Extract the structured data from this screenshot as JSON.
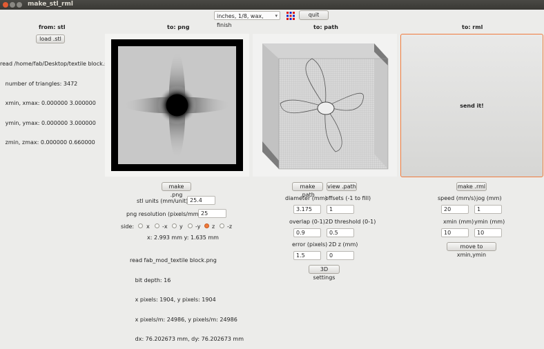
{
  "window": {
    "title": "make_stl_rml"
  },
  "toolbar": {
    "process": "inches, 1/8, wax, finish",
    "quit": "quit"
  },
  "columns": {
    "stl": {
      "header": "from: stl",
      "load": "load .stl",
      "info": [
        "read /home/fab/Desktop/textile block.stl",
        "   number of triangles: 3472",
        "   xmin, xmax: 0.000000 3.000000",
        "   ymin, ymax: 0.000000 3.000000",
        "   zmin, zmax: 0.000000 0.660000"
      ]
    },
    "png": {
      "header": "to: png",
      "make": "make .png",
      "units_label": "stl units (mm/unit):",
      "units_value": "25.4",
      "res_label": "png resolution (pixels/mm):",
      "res_value": "25",
      "side_label": "side:",
      "sides": [
        "x",
        "-x",
        "y",
        "-y",
        "z",
        "-z"
      ],
      "side_selected": "z",
      "coords": "x: 2.993 mm  y: 1.635 mm",
      "info": [
        "read fab_mod_textile block.png",
        "   bit depth: 16",
        "   x pixels: 1904, y pixels: 1904",
        "   x pixels/m: 24986, y pixels/m: 24986",
        "   dx: 76.202673 mm, dy: 76.202673 mm"
      ]
    },
    "path": {
      "header": "to: path",
      "make": "make .path",
      "view": "view .path",
      "diameter_label": "diameter (mm)",
      "diameter_value": "3.175",
      "offsets_label": "offsets (-1 to fill)",
      "offsets_value": "1",
      "overlap_label": "overlap (0-1)",
      "overlap_value": "0.9",
      "threshold_label": "2D threshold (0-1)",
      "threshold_value": "0.5",
      "error_label": "error (pixels)",
      "error_value": "1.5",
      "z2d_label": "2D z (mm)",
      "z2d_value": "0",
      "settings3d": "3D settings"
    },
    "rml": {
      "header": "to: rml",
      "send": "send it!",
      "make": "make .rml",
      "speed_label": "speed (mm/s)",
      "speed_value": "20",
      "jog_label": "jog (mm)",
      "jog_value": "1",
      "xmin_label": "xmin (mm)",
      "xmin_value": "10",
      "ymin_label": "ymin (mm)",
      "ymin_value": "10",
      "move": "move to xmin,ymin"
    }
  }
}
